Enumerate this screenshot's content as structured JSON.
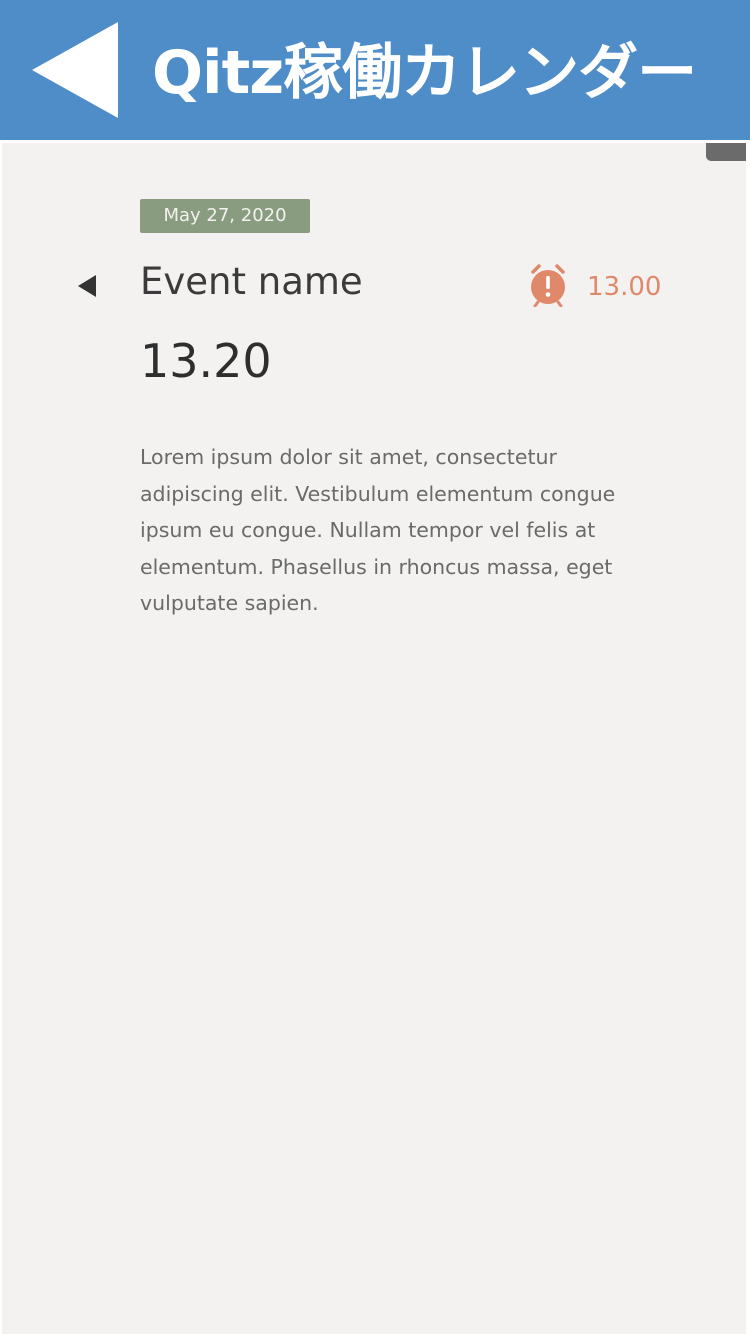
{
  "header": {
    "title": "Qitz稼働カレンダー",
    "background_color": "#4e8dc8",
    "back_icon": "back-arrow-icon"
  },
  "event": {
    "date": "May 27, 2020",
    "name": "Event name",
    "time": "13.20",
    "alarm_time": "13.00",
    "alarm_color": "#e0896a",
    "description": "Lorem ipsum dolor sit amet, consectetur adipiscing elit. Vestibulum elementum congue ipsum eu congue. Nullam tempor vel felis at elementum. Phasellus in rhoncus massa, eget vulputate sapien.",
    "prev_icon": "chevron-left-icon",
    "alarm_icon": "alarm-clock-icon"
  }
}
